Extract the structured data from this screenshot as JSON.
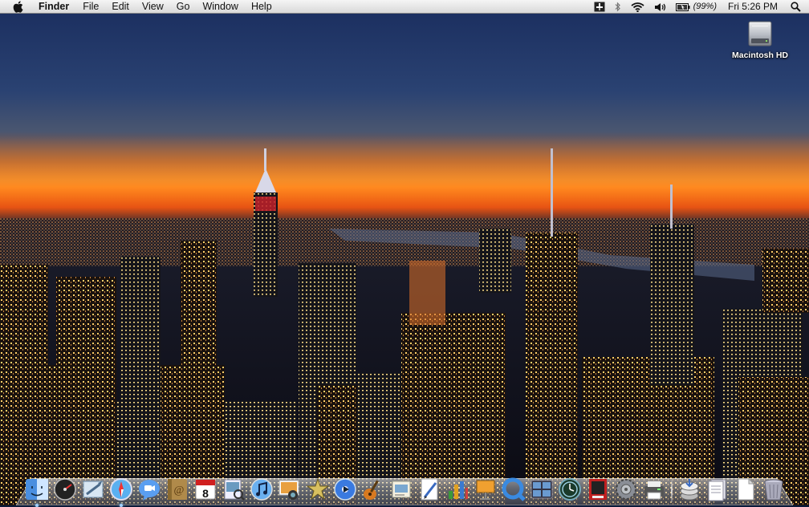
{
  "menubar": {
    "apple_icon": "apple-logo-icon",
    "app_name": "Finder",
    "menus": [
      "File",
      "Edit",
      "View",
      "Go",
      "Window",
      "Help"
    ],
    "status": {
      "battery_percent": "(99%)",
      "clock": "Fri 5:26 PM"
    }
  },
  "desktop": {
    "icons": [
      {
        "label": "Macintosh HD",
        "icon": "hard-drive-icon"
      }
    ]
  },
  "dock": {
    "apps": [
      {
        "name": "finder-icon",
        "running": true
      },
      {
        "name": "dashboard-icon",
        "running": false
      },
      {
        "name": "mail-icon",
        "running": false
      },
      {
        "name": "safari-icon",
        "running": true
      },
      {
        "name": "ichat-icon",
        "running": false
      },
      {
        "name": "address-book-icon",
        "running": false
      },
      {
        "name": "ical-icon",
        "running": false,
        "date": "8"
      },
      {
        "name": "preview-icon",
        "running": false
      },
      {
        "name": "itunes-icon",
        "running": false
      },
      {
        "name": "iphoto-icon",
        "running": false
      },
      {
        "name": "imovie-icon",
        "running": false
      },
      {
        "name": "idvd-icon",
        "running": false
      },
      {
        "name": "garageband-icon",
        "running": false
      },
      {
        "name": "iweb-icon",
        "running": false
      },
      {
        "name": "pages-icon",
        "running": false
      },
      {
        "name": "numbers-icon",
        "running": false
      },
      {
        "name": "keynote-icon",
        "running": false
      },
      {
        "name": "quicktime-icon",
        "running": false
      },
      {
        "name": "spaces-icon",
        "running": false
      },
      {
        "name": "time-machine-icon",
        "running": false
      },
      {
        "name": "photo-booth-icon",
        "running": false
      },
      {
        "name": "system-preferences-icon",
        "running": false
      },
      {
        "name": "printer-icon",
        "running": false
      }
    ],
    "docs": [
      {
        "name": "downloads-stack-icon"
      },
      {
        "name": "documents-stack-icon"
      },
      {
        "name": "document-icon"
      },
      {
        "name": "trash-icon"
      }
    ]
  }
}
